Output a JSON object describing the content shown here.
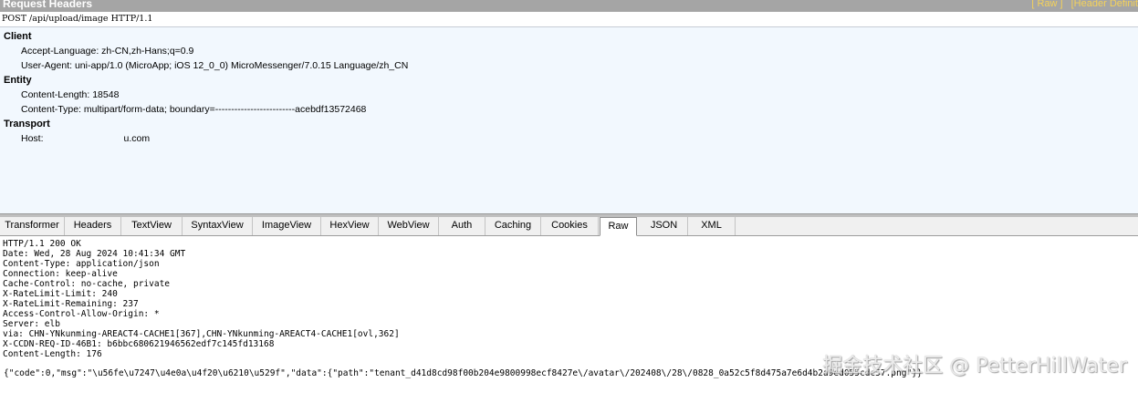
{
  "request": {
    "panel_title": "Request Headers",
    "links": [
      "[ Raw ]",
      "[Header Definit"
    ],
    "request_line": "POST /api/upload/image HTTP/1.1",
    "groups": [
      {
        "name": "Client",
        "headers": [
          "Accept-Language: zh-CN,zh-Hans;q=0.9",
          "User-Agent: uni-app/1.0 (MicroApp; iOS 12_0_0) MicroMessenger/7.0.15 Language/zh_CN"
        ]
      },
      {
        "name": "Entity",
        "headers": [
          "Content-Length: 18548",
          "Content-Type: multipart/form-data; boundary=-------------------------acebdf13572468"
        ]
      },
      {
        "name": "Transport",
        "headers": [
          "Host:",
          "u.com"
        ]
      }
    ]
  },
  "response_tabs": [
    {
      "label": "Transformer",
      "active": false
    },
    {
      "label": "Headers",
      "active": false
    },
    {
      "label": "TextView",
      "active": false
    },
    {
      "label": "SyntaxView",
      "active": false
    },
    {
      "label": "ImageView",
      "active": false
    },
    {
      "label": "HexView",
      "active": false
    },
    {
      "label": "WebView",
      "active": false
    },
    {
      "label": "Auth",
      "active": false
    },
    {
      "label": "Caching",
      "active": false
    },
    {
      "label": "Cookies",
      "active": false
    },
    {
      "label": "Raw",
      "active": true
    },
    {
      "label": "JSON",
      "active": false
    },
    {
      "label": "XML",
      "active": false
    }
  ],
  "response": {
    "lines": [
      "HTTP/1.1 200 OK",
      "Date: Wed, 28 Aug 2024 10:41:34 GMT",
      "Content-Type: application/json",
      "Connection: keep-alive",
      "Cache-Control: no-cache, private",
      "X-RateLimit-Limit: 240",
      "X-RateLimit-Remaining: 237",
      "Access-Control-Allow-Origin: *",
      "Server: elb",
      "via: CHN-YNkunming-AREACT4-CACHE1[367],CHN-YNkunming-AREACT4-CACHE1[ovl,362]",
      "X-CCDN-REQ-ID-46B1: b6bbc680621946562edf7c145fd13168",
      "Content-Length: 176"
    ],
    "body": "{\"code\":0,\"msg\":\"\\u56fe\\u7247\\u4e0a\\u4f20\\u6210\\u529f\",\"data\":{\"path\":\"tenant_d41d8cd98f00b204e9800998ecf8427e\\/avatar\\/202408\\/28\\/0828_0a52c5f8d475a7e6d4b2a9ed055cdc57.png\"}}"
  },
  "watermark": "掘金技术社区 @ PetterHillWater",
  "colors": {
    "titlebar_bg": "#a5a5a5",
    "link_color": "#f5d25a",
    "headers_bg": "#f2f8fe"
  }
}
